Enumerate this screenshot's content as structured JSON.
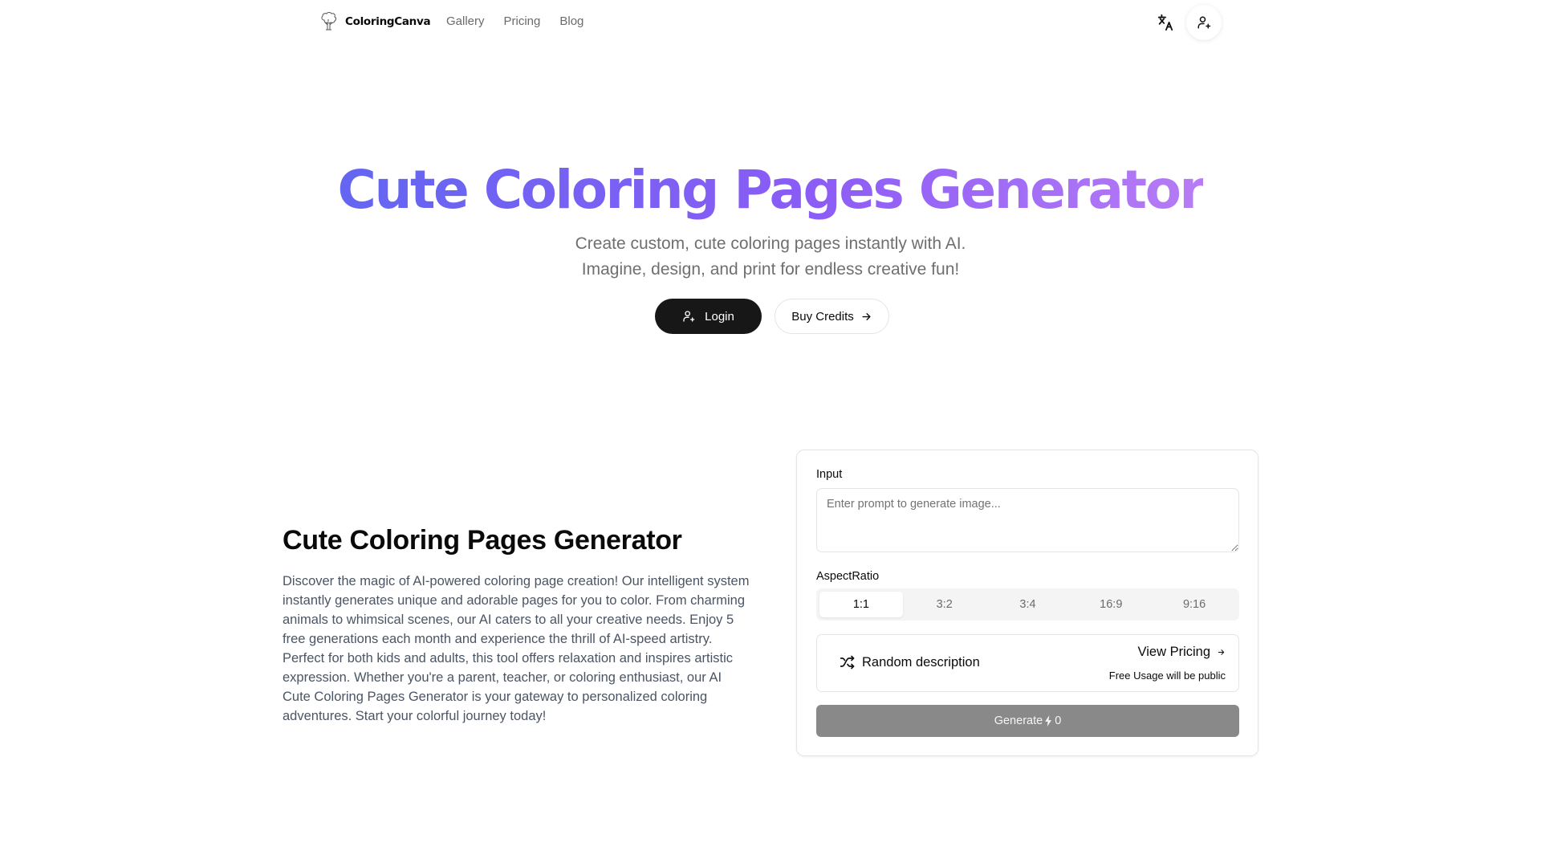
{
  "header": {
    "brand": "ColoringCanva",
    "nav": [
      {
        "label": "Gallery"
      },
      {
        "label": "Pricing"
      },
      {
        "label": "Blog"
      }
    ],
    "icons": {
      "translate": "translate-icon",
      "user": "user-plus-icon",
      "logo": "tree-icon"
    }
  },
  "hero": {
    "title": "Cute Coloring Pages Generator",
    "subtitle_line1": "Create custom, cute coloring pages instantly with AI.",
    "subtitle_line2": "Imagine, design, and print for endless creative fun!",
    "login_label": "Login",
    "buy_credits_label": "Buy Credits",
    "gradient_colors": [
      "#6366f1",
      "#8b5cf6",
      "#b77cf5"
    ]
  },
  "intro": {
    "title": "Cute Coloring Pages Generator",
    "description": "Discover the magic of AI-powered coloring page creation! Our intelligent system instantly generates unique and adorable pages for you to color. From charming animals to whimsical scenes, our AI caters to all your creative needs. Enjoy 5 free generations each month and experience the thrill of AI-speed artistry. Perfect for both kids and adults, this tool offers relaxation and inspires artistic expression. Whether you're a parent, teacher, or coloring enthusiast, our AI Cute Coloring Pages Generator is your gateway to personalized coloring adventures. Start your colorful journey today!"
  },
  "generator": {
    "input_label": "Input",
    "input_value": "",
    "input_placeholder": "Enter prompt to generate image...",
    "aspect_label": "AspectRatio",
    "aspect_options": [
      {
        "label": "1:1",
        "selected": true
      },
      {
        "label": "3:2",
        "selected": false
      },
      {
        "label": "3:4",
        "selected": false
      },
      {
        "label": "16:9",
        "selected": false
      },
      {
        "label": "9:16",
        "selected": false
      }
    ],
    "random_label": "Random description",
    "view_pricing_label": "View Pricing",
    "free_note": "Free Usage will be public",
    "generate_label": "Generate",
    "credits_cost": "0"
  }
}
